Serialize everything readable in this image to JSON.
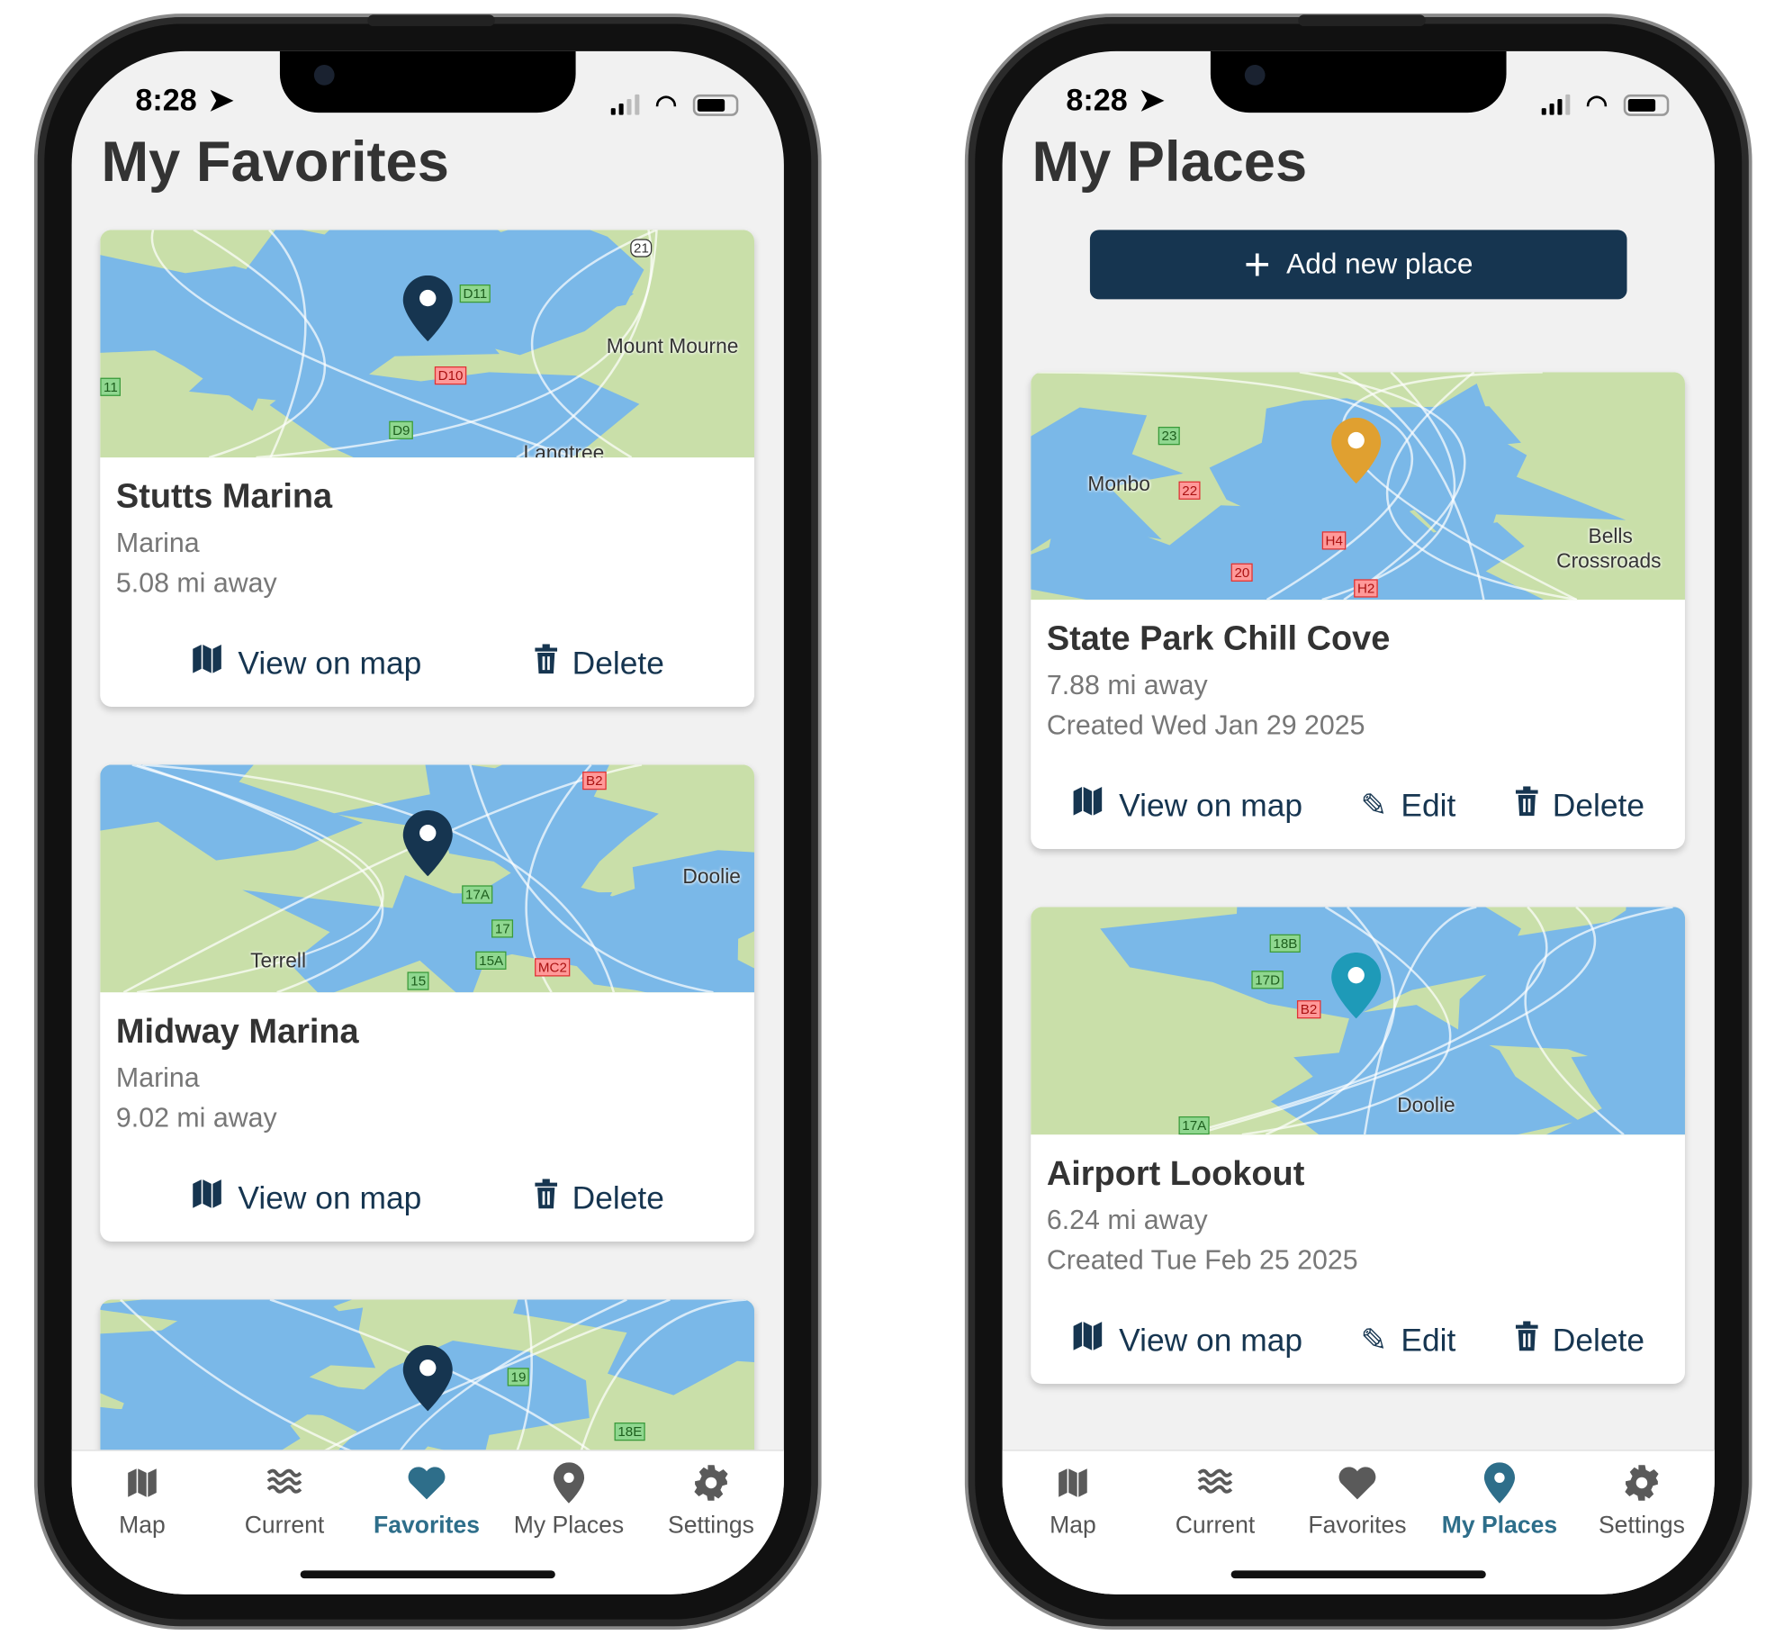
{
  "status_bar": {
    "time": "8:28"
  },
  "colors": {
    "navy": "#163550",
    "active_tab": "#2e6e8a",
    "water": "#7ab8e8",
    "land": "#c9dfa9",
    "pin_gold": "#e0a030",
    "pin_teal": "#1e9ab8"
  },
  "favorites_screen": {
    "title": "My Favorites",
    "cards": [
      {
        "name": "Stutts Marina",
        "type": "Marina",
        "distance": "5.08 mi away",
        "view_label": "View on map",
        "delete_label": "Delete",
        "map_labels": [
          "Mount Mourne",
          "Langtree",
          "21",
          "D11",
          "D10",
          "D9",
          "11"
        ]
      },
      {
        "name": "Midway Marina",
        "type": "Marina",
        "distance": "9.02 mi away",
        "view_label": "View on map",
        "delete_label": "Delete",
        "map_labels": [
          "Doolie",
          "Terrell",
          "17A",
          "17",
          "15A",
          "15",
          "MC2",
          "B2"
        ]
      },
      {
        "map_labels": [
          "19",
          "18E"
        ]
      }
    ]
  },
  "places_screen": {
    "title": "My Places",
    "add_label": "Add new place",
    "cards": [
      {
        "name": "State Park Chill Cove",
        "distance": "7.88 mi away",
        "created": "Created Wed Jan 29 2025",
        "view_label": "View on map",
        "edit_label": "Edit",
        "delete_label": "Delete",
        "pin_color": "gold",
        "map_labels": [
          "Monbo",
          "Bells",
          "Crossroads",
          "23",
          "22",
          "20",
          "H4",
          "H2"
        ]
      },
      {
        "name": "Airport Lookout",
        "distance": "6.24 mi away",
        "created": "Created Tue Feb 25 2025",
        "view_label": "View on map",
        "edit_label": "Edit",
        "delete_label": "Delete",
        "pin_color": "teal",
        "map_labels": [
          "Doolie",
          "18B",
          "17D",
          "B2",
          "17A"
        ]
      }
    ]
  },
  "tabs": [
    {
      "label": "Map",
      "icon": "map-icon"
    },
    {
      "label": "Current",
      "icon": "waves-icon"
    },
    {
      "label": "Favorites",
      "icon": "heart-icon"
    },
    {
      "label": "My Places",
      "icon": "location-pin-icon"
    },
    {
      "label": "Settings",
      "icon": "gear-icon"
    }
  ]
}
